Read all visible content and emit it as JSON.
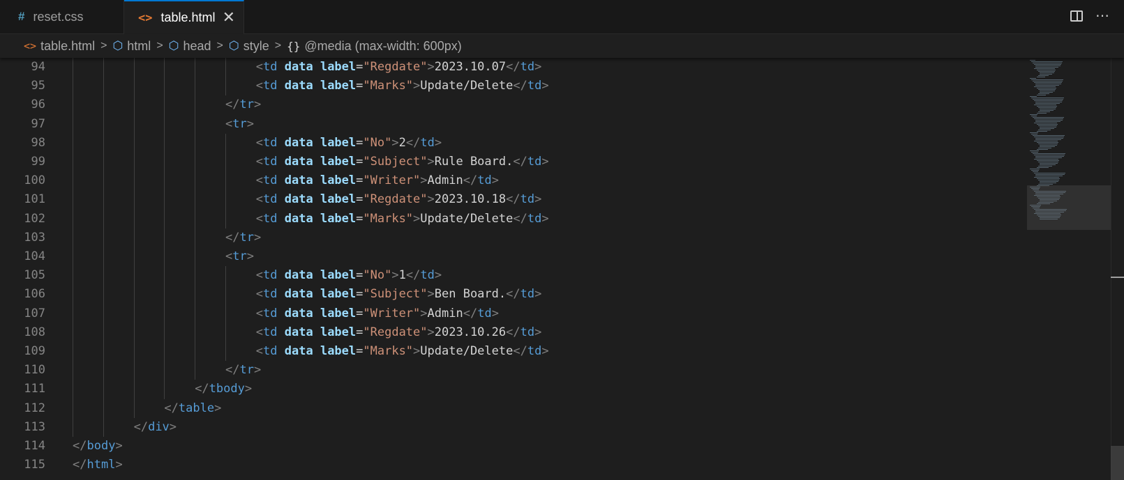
{
  "tabs": [
    {
      "icon": "#",
      "label": "reset.css",
      "active": false
    },
    {
      "icon": "<>",
      "label": "table.html",
      "active": true,
      "close": "✕"
    }
  ],
  "breadcrumb": [
    {
      "icon": "<>",
      "label": "table.html"
    },
    {
      "icon": "cube-icon",
      "label": "html"
    },
    {
      "icon": "cube-icon",
      "label": "head"
    },
    {
      "icon": "cube-icon",
      "label": "style"
    },
    {
      "icon": "{}",
      "label": "@media (max-width: 600px)"
    }
  ],
  "editor": {
    "lines": [
      {
        "n": "94",
        "indent": 6,
        "tokens": [
          [
            "p",
            "<"
          ],
          [
            "t",
            "td"
          ],
          [
            "a",
            " data"
          ],
          [
            "a",
            " label"
          ],
          [
            "e",
            "="
          ],
          [
            "s",
            "\"Regdate\""
          ],
          [
            "p",
            ">"
          ],
          [
            "x",
            "2023.10.07"
          ],
          [
            "p",
            "</"
          ],
          [
            "t",
            "td"
          ],
          [
            "p",
            ">"
          ]
        ]
      },
      {
        "n": "95",
        "indent": 6,
        "tokens": [
          [
            "p",
            "<"
          ],
          [
            "t",
            "td"
          ],
          [
            "a",
            " data"
          ],
          [
            "a",
            " label"
          ],
          [
            "e",
            "="
          ],
          [
            "s",
            "\"Marks\""
          ],
          [
            "p",
            ">"
          ],
          [
            "x",
            "Update/Delete"
          ],
          [
            "p",
            "</"
          ],
          [
            "t",
            "td"
          ],
          [
            "p",
            ">"
          ]
        ]
      },
      {
        "n": "96",
        "indent": 5,
        "tokens": [
          [
            "p",
            "</"
          ],
          [
            "t",
            "tr"
          ],
          [
            "p",
            ">"
          ]
        ]
      },
      {
        "n": "97",
        "indent": 5,
        "tokens": [
          [
            "p",
            "<"
          ],
          [
            "t",
            "tr"
          ],
          [
            "p",
            ">"
          ]
        ]
      },
      {
        "n": "98",
        "indent": 6,
        "tokens": [
          [
            "p",
            "<"
          ],
          [
            "t",
            "td"
          ],
          [
            "a",
            " data"
          ],
          [
            "a",
            " label"
          ],
          [
            "e",
            "="
          ],
          [
            "s",
            "\"No\""
          ],
          [
            "p",
            ">"
          ],
          [
            "x",
            "2"
          ],
          [
            "p",
            "</"
          ],
          [
            "t",
            "td"
          ],
          [
            "p",
            ">"
          ]
        ]
      },
      {
        "n": "99",
        "indent": 6,
        "tokens": [
          [
            "p",
            "<"
          ],
          [
            "t",
            "td"
          ],
          [
            "a",
            " data"
          ],
          [
            "a",
            " label"
          ],
          [
            "e",
            "="
          ],
          [
            "s",
            "\"Subject\""
          ],
          [
            "p",
            ">"
          ],
          [
            "x",
            "Rule Board."
          ],
          [
            "p",
            "</"
          ],
          [
            "t",
            "td"
          ],
          [
            "p",
            ">"
          ]
        ]
      },
      {
        "n": "100",
        "indent": 6,
        "tokens": [
          [
            "p",
            "<"
          ],
          [
            "t",
            "td"
          ],
          [
            "a",
            " data"
          ],
          [
            "a",
            " label"
          ],
          [
            "e",
            "="
          ],
          [
            "s",
            "\"Writer\""
          ],
          [
            "p",
            ">"
          ],
          [
            "x",
            "Admin"
          ],
          [
            "p",
            "</"
          ],
          [
            "t",
            "td"
          ],
          [
            "p",
            ">"
          ]
        ]
      },
      {
        "n": "101",
        "indent": 6,
        "tokens": [
          [
            "p",
            "<"
          ],
          [
            "t",
            "td"
          ],
          [
            "a",
            " data"
          ],
          [
            "a",
            " label"
          ],
          [
            "e",
            "="
          ],
          [
            "s",
            "\"Regdate\""
          ],
          [
            "p",
            ">"
          ],
          [
            "x",
            "2023.10.18"
          ],
          [
            "p",
            "</"
          ],
          [
            "t",
            "td"
          ],
          [
            "p",
            ">"
          ]
        ]
      },
      {
        "n": "102",
        "indent": 6,
        "tokens": [
          [
            "p",
            "<"
          ],
          [
            "t",
            "td"
          ],
          [
            "a",
            " data"
          ],
          [
            "a",
            " label"
          ],
          [
            "e",
            "="
          ],
          [
            "s",
            "\"Marks\""
          ],
          [
            "p",
            ">"
          ],
          [
            "x",
            "Update/Delete"
          ],
          [
            "p",
            "</"
          ],
          [
            "t",
            "td"
          ],
          [
            "p",
            ">"
          ]
        ]
      },
      {
        "n": "103",
        "indent": 5,
        "tokens": [
          [
            "p",
            "</"
          ],
          [
            "t",
            "tr"
          ],
          [
            "p",
            ">"
          ]
        ]
      },
      {
        "n": "104",
        "indent": 5,
        "tokens": [
          [
            "p",
            "<"
          ],
          [
            "t",
            "tr"
          ],
          [
            "p",
            ">"
          ]
        ]
      },
      {
        "n": "105",
        "indent": 6,
        "tokens": [
          [
            "p",
            "<"
          ],
          [
            "t",
            "td"
          ],
          [
            "a",
            " data"
          ],
          [
            "a",
            " label"
          ],
          [
            "e",
            "="
          ],
          [
            "s",
            "\"No\""
          ],
          [
            "p",
            ">"
          ],
          [
            "x",
            "1"
          ],
          [
            "p",
            "</"
          ],
          [
            "t",
            "td"
          ],
          [
            "p",
            ">"
          ]
        ]
      },
      {
        "n": "106",
        "indent": 6,
        "tokens": [
          [
            "p",
            "<"
          ],
          [
            "t",
            "td"
          ],
          [
            "a",
            " data"
          ],
          [
            "a",
            " label"
          ],
          [
            "e",
            "="
          ],
          [
            "s",
            "\"Subject\""
          ],
          [
            "p",
            ">"
          ],
          [
            "x",
            "Ben Board."
          ],
          [
            "p",
            "</"
          ],
          [
            "t",
            "td"
          ],
          [
            "p",
            ">"
          ]
        ]
      },
      {
        "n": "107",
        "indent": 6,
        "tokens": [
          [
            "p",
            "<"
          ],
          [
            "t",
            "td"
          ],
          [
            "a",
            " data"
          ],
          [
            "a",
            " label"
          ],
          [
            "e",
            "="
          ],
          [
            "s",
            "\"Writer\""
          ],
          [
            "p",
            ">"
          ],
          [
            "x",
            "Admin"
          ],
          [
            "p",
            "</"
          ],
          [
            "t",
            "td"
          ],
          [
            "p",
            ">"
          ]
        ]
      },
      {
        "n": "108",
        "indent": 6,
        "tokens": [
          [
            "p",
            "<"
          ],
          [
            "t",
            "td"
          ],
          [
            "a",
            " data"
          ],
          [
            "a",
            " label"
          ],
          [
            "e",
            "="
          ],
          [
            "s",
            "\"Regdate\""
          ],
          [
            "p",
            ">"
          ],
          [
            "x",
            "2023.10.26"
          ],
          [
            "p",
            "</"
          ],
          [
            "t",
            "td"
          ],
          [
            "p",
            ">"
          ]
        ]
      },
      {
        "n": "109",
        "indent": 6,
        "tokens": [
          [
            "p",
            "<"
          ],
          [
            "t",
            "td"
          ],
          [
            "a",
            " data"
          ],
          [
            "a",
            " label"
          ],
          [
            "e",
            "="
          ],
          [
            "s",
            "\"Marks\""
          ],
          [
            "p",
            ">"
          ],
          [
            "x",
            "Update/Delete"
          ],
          [
            "p",
            "</"
          ],
          [
            "t",
            "td"
          ],
          [
            "p",
            ">"
          ]
        ]
      },
      {
        "n": "110",
        "indent": 5,
        "tokens": [
          [
            "p",
            "</"
          ],
          [
            "t",
            "tr"
          ],
          [
            "p",
            ">"
          ]
        ]
      },
      {
        "n": "111",
        "indent": 4,
        "tokens": [
          [
            "p",
            "</"
          ],
          [
            "t",
            "tbody"
          ],
          [
            "p",
            ">"
          ]
        ]
      },
      {
        "n": "112",
        "indent": 3,
        "tokens": [
          [
            "p",
            "</"
          ],
          [
            "t",
            "table"
          ],
          [
            "p",
            ">"
          ]
        ]
      },
      {
        "n": "113",
        "indent": 2,
        "tokens": [
          [
            "p",
            "</"
          ],
          [
            "t",
            "div"
          ],
          [
            "p",
            ">"
          ]
        ]
      },
      {
        "n": "114",
        "indent": 0,
        "tokens": [
          [
            "p",
            "</"
          ],
          [
            "t",
            "body"
          ],
          [
            "p",
            ">"
          ]
        ]
      },
      {
        "n": "115",
        "indent": 0,
        "tokens": [
          [
            "p",
            "</"
          ],
          [
            "t",
            "html"
          ],
          [
            "p",
            ">"
          ]
        ]
      }
    ]
  },
  "colors": {
    "tag": "#569cd6",
    "attribute": "#9cdcfe",
    "string": "#ce9178",
    "text": "#d4d4d4",
    "punctuation": "#808080",
    "accent": "#0078d4"
  },
  "icons": {
    "css_file": "hash-icon",
    "html_file": "code-brackets-icon",
    "close": "close-icon",
    "split": "split-editor-icon",
    "more": "more-actions-icon"
  }
}
